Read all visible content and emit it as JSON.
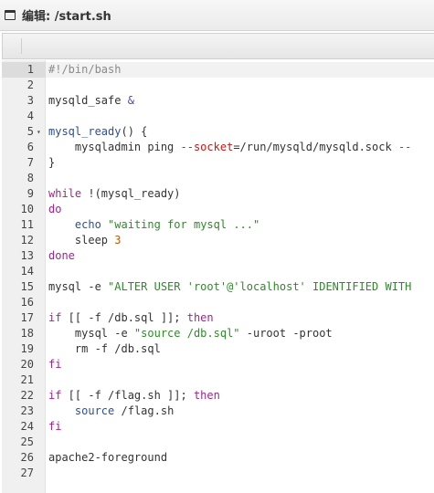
{
  "window": {
    "title": "编辑: /start.sh",
    "icon": "window-icon"
  },
  "editor": {
    "active_line": 1,
    "foldable_lines": [
      5
    ],
    "lines": [
      {
        "n": "1",
        "tokens": [
          {
            "t": "#!/bin/bash",
            "c": "comment"
          }
        ]
      },
      {
        "n": "2",
        "tokens": []
      },
      {
        "n": "3",
        "tokens": [
          {
            "t": "mysqld_safe ",
            "c": "plain"
          },
          {
            "t": "&",
            "c": "op"
          }
        ]
      },
      {
        "n": "4",
        "tokens": []
      },
      {
        "n": "5",
        "tokens": [
          {
            "t": "mysql_ready",
            "c": "func"
          },
          {
            "t": "() {",
            "c": "plain"
          }
        ]
      },
      {
        "n": "6",
        "tokens": [
          {
            "t": "    mysqladmin ping ",
            "c": "plain"
          },
          {
            "t": "--",
            "c": "op"
          },
          {
            "t": "socket",
            "c": "var"
          },
          {
            "t": "=/run/mysqld/mysqld.sock ",
            "c": "plain"
          },
          {
            "t": "--",
            "c": "op"
          }
        ]
      },
      {
        "n": "7",
        "tokens": [
          {
            "t": "}",
            "c": "plain"
          }
        ]
      },
      {
        "n": "8",
        "tokens": []
      },
      {
        "n": "9",
        "tokens": [
          {
            "t": "while",
            "c": "keyword"
          },
          {
            "t": " !(mysql_ready)",
            "c": "plain"
          }
        ]
      },
      {
        "n": "10",
        "tokens": [
          {
            "t": "do",
            "c": "keyword"
          }
        ]
      },
      {
        "n": "11",
        "tokens": [
          {
            "t": "    ",
            "c": "plain"
          },
          {
            "t": "echo",
            "c": "func"
          },
          {
            "t": " ",
            "c": "plain"
          },
          {
            "t": "\"waiting for mysql ...\"",
            "c": "string"
          }
        ]
      },
      {
        "n": "12",
        "tokens": [
          {
            "t": "    sleep ",
            "c": "plain"
          },
          {
            "t": "3",
            "c": "number"
          }
        ]
      },
      {
        "n": "13",
        "tokens": [
          {
            "t": "done",
            "c": "keyword"
          }
        ]
      },
      {
        "n": "14",
        "tokens": []
      },
      {
        "n": "15",
        "tokens": [
          {
            "t": "mysql -e ",
            "c": "plain"
          },
          {
            "t": "\"ALTER USER 'root'@'localhost' IDENTIFIED WITH",
            "c": "string"
          }
        ]
      },
      {
        "n": "16",
        "tokens": []
      },
      {
        "n": "17",
        "tokens": [
          {
            "t": "if",
            "c": "keyword"
          },
          {
            "t": " [[ -f /db.sql ]]; ",
            "c": "plain"
          },
          {
            "t": "then",
            "c": "keyword"
          }
        ]
      },
      {
        "n": "18",
        "tokens": [
          {
            "t": "    mysql -e ",
            "c": "plain"
          },
          {
            "t": "\"source /db.sql\"",
            "c": "string"
          },
          {
            "t": " -uroot -proot",
            "c": "plain"
          }
        ]
      },
      {
        "n": "19",
        "tokens": [
          {
            "t": "    rm -f /db.sql",
            "c": "plain"
          }
        ]
      },
      {
        "n": "20",
        "tokens": [
          {
            "t": "fi",
            "c": "keyword"
          }
        ]
      },
      {
        "n": "21",
        "tokens": []
      },
      {
        "n": "22",
        "tokens": [
          {
            "t": "if",
            "c": "keyword"
          },
          {
            "t": " [[ -f /flag.sh ]]; ",
            "c": "plain"
          },
          {
            "t": "then",
            "c": "keyword"
          }
        ]
      },
      {
        "n": "23",
        "tokens": [
          {
            "t": "    ",
            "c": "plain"
          },
          {
            "t": "source",
            "c": "func"
          },
          {
            "t": " /flag.sh",
            "c": "plain"
          }
        ]
      },
      {
        "n": "24",
        "tokens": [
          {
            "t": "fi",
            "c": "keyword"
          }
        ]
      },
      {
        "n": "25",
        "tokens": []
      },
      {
        "n": "26",
        "tokens": [
          {
            "t": "apache2-foreground",
            "c": "plain"
          }
        ]
      },
      {
        "n": "27",
        "tokens": []
      }
    ]
  }
}
